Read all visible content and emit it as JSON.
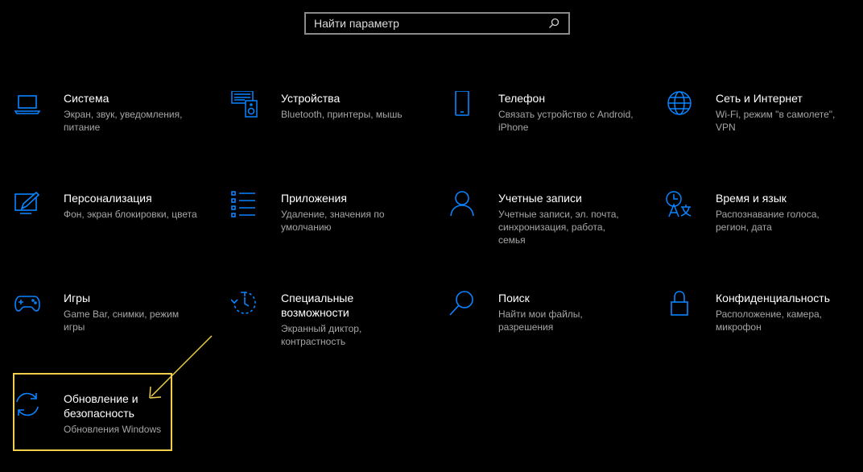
{
  "search": {
    "placeholder": "Найти параметр"
  },
  "tiles": [
    {
      "title": "Система",
      "desc": "Экран, звук, уведомления, питание",
      "icon": "laptop-icon"
    },
    {
      "title": "Устройства",
      "desc": "Bluetooth, принтеры, мышь",
      "icon": "devices-icon"
    },
    {
      "title": "Телефон",
      "desc": "Связать устройство с Android, iPhone",
      "icon": "phone-icon"
    },
    {
      "title": "Сеть и Интернет",
      "desc": "Wi-Fi, режим \"в самолете\", VPN",
      "icon": "globe-icon"
    },
    {
      "title": "Персонализация",
      "desc": "Фон, экран блокировки, цвета",
      "icon": "paint-icon"
    },
    {
      "title": "Приложения",
      "desc": "Удаление, значения по умолчанию",
      "icon": "apps-list-icon"
    },
    {
      "title": "Учетные записи",
      "desc": "Учетные записи, эл. почта, синхронизация, работа, семья",
      "icon": "person-icon"
    },
    {
      "title": "Время и язык",
      "desc": "Распознавание голоса, регион, дата",
      "icon": "time-language-icon"
    },
    {
      "title": "Игры",
      "desc": "Game Bar, снимки, режим игры",
      "icon": "gamepad-icon"
    },
    {
      "title": "Специальные возможности",
      "desc": "Экранный диктор, контрастность",
      "icon": "accessibility-icon"
    },
    {
      "title": "Поиск",
      "desc": "Найти мои файлы, разрешения",
      "icon": "search-icon"
    },
    {
      "title": "Конфиденциальность",
      "desc": "Расположение, камера, микрофон",
      "icon": "lock-icon"
    },
    {
      "title": "Обновление и безопасность",
      "desc": "Обновления Windows",
      "icon": "update-sync-icon"
    }
  ],
  "colors": {
    "accent": "#0a84ff",
    "highlight": "#f2cf4a",
    "desc": "#a6a6a6"
  }
}
